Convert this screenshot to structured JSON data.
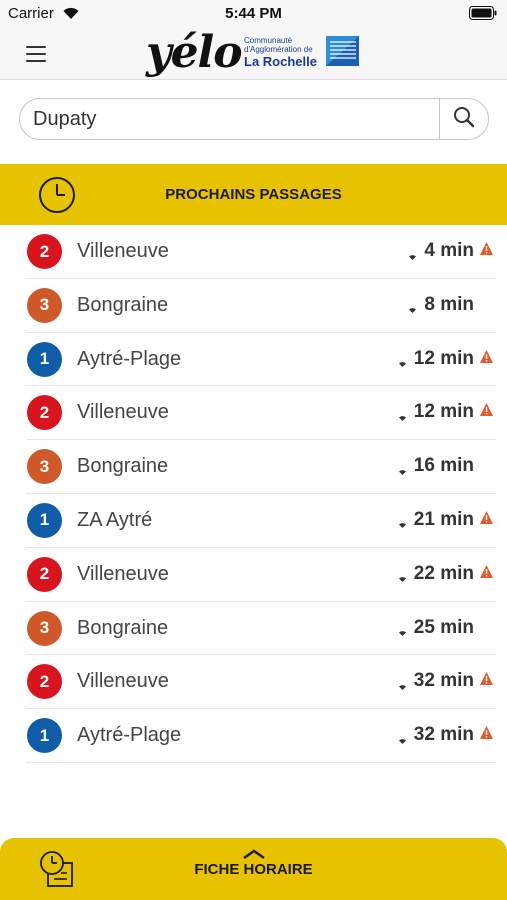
{
  "status_bar": {
    "carrier": "Carrier",
    "time": "5:44 PM"
  },
  "header": {
    "logo_text": "yélo",
    "partner_line1": "Communauté",
    "partner_line2": "d'Agglomération de",
    "partner_line3": "La Rochelle"
  },
  "search": {
    "value": "Dupaty",
    "placeholder": ""
  },
  "section": {
    "title": "PROCHAINS PASSAGES"
  },
  "colors": {
    "accent": "#e6c200",
    "line_1": "#0f5da6",
    "line_2": "#d9141e",
    "line_3": "#d0592a",
    "warning": "#e8592a"
  },
  "departures": [
    {
      "line": "2",
      "destination": "Villeneuve",
      "time": "4 min",
      "warning": true
    },
    {
      "line": "3",
      "destination": "Bongraine",
      "time": "8 min",
      "warning": false
    },
    {
      "line": "1",
      "destination": "Aytré-Plage",
      "time": "12 min",
      "warning": true
    },
    {
      "line": "2",
      "destination": "Villeneuve",
      "time": "12 min",
      "warning": true
    },
    {
      "line": "3",
      "destination": "Bongraine",
      "time": "16 min",
      "warning": false
    },
    {
      "line": "1",
      "destination": "ZA Aytré",
      "time": "21 min",
      "warning": true
    },
    {
      "line": "2",
      "destination": "Villeneuve",
      "time": "22 min",
      "warning": true
    },
    {
      "line": "3",
      "destination": "Bongraine",
      "time": "25 min",
      "warning": false
    },
    {
      "line": "2",
      "destination": "Villeneuve",
      "time": "32 min",
      "warning": true
    },
    {
      "line": "1",
      "destination": "Aytré-Plage",
      "time": "32 min",
      "warning": true
    }
  ],
  "icons": {
    "menu": "hamburger-icon",
    "search": "search-icon",
    "clock": "clock-icon",
    "realtime": "realtime-signal-icon",
    "warning": "warning-icon",
    "timetable": "timetable-icon",
    "expand": "chevron-up-icon"
  },
  "footer": {
    "label": "FICHE HORAIRE"
  }
}
